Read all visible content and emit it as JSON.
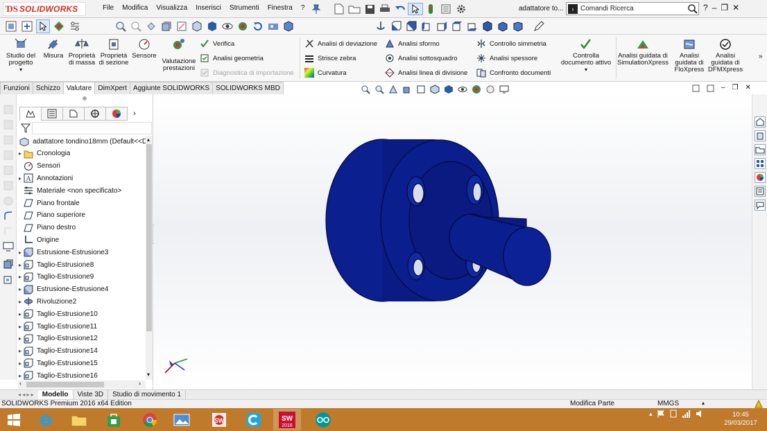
{
  "app": {
    "brand": "SOLIDWORKS",
    "doc_title": "adattatore to..."
  },
  "menu": [
    "File",
    "Modifica",
    "Visualizza",
    "Inserisci",
    "Strumenti",
    "Finestra",
    "?"
  ],
  "search": {
    "label": "Comandi Ricerca"
  },
  "ribbon": {
    "big_buttons": [
      {
        "label": "Studio del progetto",
        "icon": "design-study-icon"
      },
      {
        "label": "Misura",
        "icon": "measure-icon"
      },
      {
        "label": "Proprietà di massa",
        "icon": "mass-properties-icon"
      },
      {
        "label": "Proprietà di sezione",
        "icon": "section-properties-icon"
      },
      {
        "label": "Sensore",
        "icon": "sensor-icon"
      },
      {
        "label": "Valutazione prestazioni",
        "icon": "performance-evaluation-icon"
      }
    ],
    "col1": [
      {
        "label": "Verifica",
        "disabled": false
      },
      {
        "label": "Analisi geometria",
        "disabled": false
      },
      {
        "label": "Diagnostica di importazione",
        "disabled": true
      }
    ],
    "col2": [
      {
        "label": "Analisi di deviazione"
      },
      {
        "label": "Strisce zebra"
      },
      {
        "label": "Curvatura"
      }
    ],
    "col3": [
      {
        "label": "Analisi sformo"
      },
      {
        "label": "Analisi sottosquadro"
      },
      {
        "label": "Analisi linea di divisione"
      }
    ],
    "col4": [
      {
        "label": "Controllo simmetria"
      },
      {
        "label": "Analisi spessore"
      },
      {
        "label": "Confronto documenti"
      }
    ],
    "check_active": {
      "label": "Controlla documento attivo"
    },
    "xpress": [
      {
        "label": "Analisi guidata di SimulationXpress"
      },
      {
        "label": "Analisi guidata di FloXpress"
      },
      {
        "label": "Analisi guidata di DFMXpress"
      }
    ]
  },
  "command_tabs": [
    {
      "label": "Funzioni",
      "active": false
    },
    {
      "label": "Schizzo",
      "active": false
    },
    {
      "label": "Valutare",
      "active": true
    },
    {
      "label": "DimXpert",
      "active": false
    },
    {
      "label": "Aggiunte SOLIDWORKS",
      "active": false
    },
    {
      "label": "SOLIDWORKS MBD",
      "active": false
    }
  ],
  "tree": {
    "root": "adattatore tondino18mm  (Default<<D",
    "items": [
      {
        "label": "Cronologia",
        "expandable": true,
        "icon": "history-folder-icon"
      },
      {
        "label": "Sensori",
        "expandable": false,
        "icon": "sensors-icon"
      },
      {
        "label": "Annotazioni",
        "expandable": true,
        "icon": "annotations-icon"
      },
      {
        "label": "Materiale <non specificato>",
        "expandable": false,
        "icon": "material-icon"
      },
      {
        "label": "Piano frontale",
        "expandable": false,
        "icon": "plane-icon"
      },
      {
        "label": "Piano superiore",
        "expandable": false,
        "icon": "plane-icon"
      },
      {
        "label": "Piano destro",
        "expandable": false,
        "icon": "plane-icon"
      },
      {
        "label": "Origine",
        "expandable": false,
        "icon": "origin-icon"
      },
      {
        "label": "Estrusione-Estrusione3",
        "expandable": true,
        "icon": "extrude-icon"
      },
      {
        "label": "Taglio-Estrusione8",
        "expandable": true,
        "icon": "cut-extrude-icon"
      },
      {
        "label": "Taglio-Estrusione9",
        "expandable": true,
        "icon": "cut-extrude-icon"
      },
      {
        "label": "Estrusione-Estrusione4",
        "expandable": true,
        "icon": "extrude-icon"
      },
      {
        "label": "Rivoluzione2",
        "expandable": true,
        "icon": "revolve-icon"
      },
      {
        "label": "Taglio-Estrusione10",
        "expandable": true,
        "icon": "cut-extrude-icon"
      },
      {
        "label": "Taglio-Estrusione11",
        "expandable": true,
        "icon": "cut-extrude-icon"
      },
      {
        "label": "Taglio-Estrusione12",
        "expandable": true,
        "icon": "cut-extrude-icon"
      },
      {
        "label": "Taglio-Estrusione14",
        "expandable": true,
        "icon": "cut-extrude-icon"
      },
      {
        "label": "Taglio-Estrusione15",
        "expandable": true,
        "icon": "cut-extrude-icon"
      },
      {
        "label": "Taglio-Estrusione16",
        "expandable": true,
        "icon": "cut-extrude-icon"
      }
    ]
  },
  "bottom_tabs": [
    {
      "label": "Modello",
      "active": true
    },
    {
      "label": "Viste 3D",
      "active": false
    },
    {
      "label": "Studio di movimento 1",
      "active": false
    }
  ],
  "status": {
    "edition": "SOLIDWORKS Premium 2016 x64 Edition",
    "mode": "Modifica Parte",
    "units": "MMGS"
  },
  "taskbar": {
    "apps": [
      "start-icon",
      "internet-explorer-icon",
      "file-explorer-icon",
      "store-icon",
      "chrome-icon",
      "photos-icon",
      "solidworks-launcher-icon",
      "cortona-icon",
      "solidworks-2016-icon",
      "arduino-icon"
    ],
    "time": "10:45",
    "date": "29/03/2017"
  },
  "colors": {
    "part_blue": "#0a1e8c",
    "taskbar": "#c07a2b",
    "brand_red": "#d52b1e"
  }
}
